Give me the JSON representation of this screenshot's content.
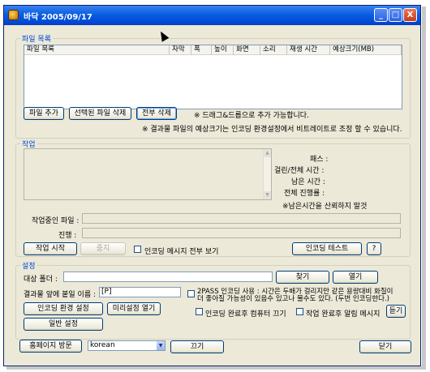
{
  "window": {
    "title": "바닥 2005/09/17",
    "min_label": "_",
    "max_label": "□",
    "close_label": "X"
  },
  "file_list": {
    "group_label": "파일 목록",
    "columns": [
      "파일 목록",
      "자막",
      "폭",
      "높이",
      "화면",
      "소리",
      "재생 시간",
      "예상크기(MB)"
    ],
    "add_button": "파일 추가",
    "delete_selected_button": "선택된 파일 삭제",
    "delete_all_button": "전부 삭제",
    "drag_drop_note": "※ 드래그&드롭으로 추가 가능합니다.",
    "size_note": "※ 결과물 파일의 예상크기는 인코딩 환경설정에서 비트레이트로 조정 할 수 있습니다."
  },
  "work": {
    "group_label": "작업",
    "pass_label": "패스 :",
    "elapsed_total_label": "걸린/전체 시간 :",
    "remaining_label": "남은 시간 :",
    "total_progress_label": "전체 진행률 :",
    "remaining_note": "※남은시간을 산뢰하지 말것",
    "current_file_label": "작업중인 파일 :",
    "progress_label": "진행 :",
    "start_button": "작업 시작",
    "stop_button": "중지",
    "show_all_messages_label": "인코딩 메시지 전부 보기",
    "encoding_test_button": "인코딩 테스트",
    "help_button": "?"
  },
  "settings": {
    "group_label": "설정",
    "target_folder_label": "대상 폴더 :",
    "target_folder_value": "",
    "find_button": "찾기",
    "open_button": "열기",
    "prefix_label": "결과물 앞에 붙일 이름 :",
    "prefix_value": "[P]",
    "twopass_text_line1": "2PASS 인코딩 사용 : 시간은 두배가 걸리지만 같은 용량대비 화질이",
    "twopass_text_line2": "더 좋아질 가능성이 있음수 있고나 물수도 있다. (두번 인코딩한다.)",
    "encoding_env_button": "인코딩 환경 설정",
    "preset_open_button": "미리설정 열기",
    "general_settings_button": "일반 설정",
    "shutdown_label": "인코딩 완료후 컴퓨터 끄기",
    "notify_label": "작업 완료후 알림 메시지",
    "listen_button": "듣기"
  },
  "footer": {
    "homepage_button": "홈페이지 방문",
    "language_value": "korean",
    "quit_button": "끄기",
    "close_button": "닫기"
  }
}
